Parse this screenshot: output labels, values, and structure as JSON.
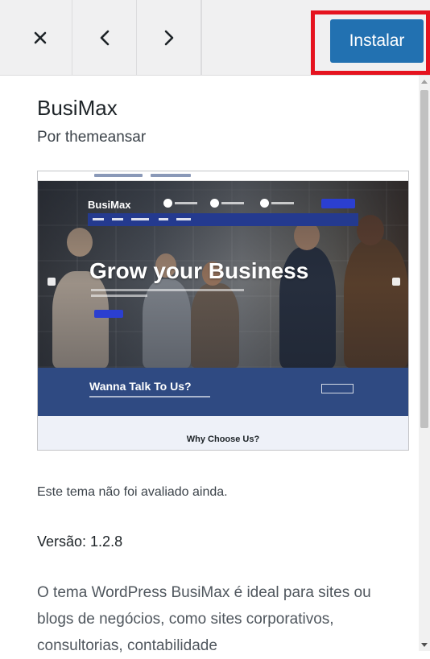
{
  "toolbar": {
    "close_icon": "close-icon",
    "previous_icon": "chevron-left-icon",
    "next_icon": "chevron-right-icon",
    "install_label": "Instalar",
    "install_color": "#2271b1",
    "highlight_color": "#e5131f"
  },
  "theme": {
    "name": "BusiMax",
    "author": "Por themeansar",
    "screenshot": {
      "brand": "BusiMax",
      "hero_title": "Grow your Business",
      "cta_title": "Wanna Talk To Us?",
      "section_title": "Why Choose Us?"
    },
    "rating_text": "Este tema não foi avaliado ainda.",
    "version": "Versão: 1.2.8",
    "description": "O tema WordPress BusiMax é ideal para sites ou blogs de negócios, como sites corporativos, consultorias, contabilidade"
  }
}
